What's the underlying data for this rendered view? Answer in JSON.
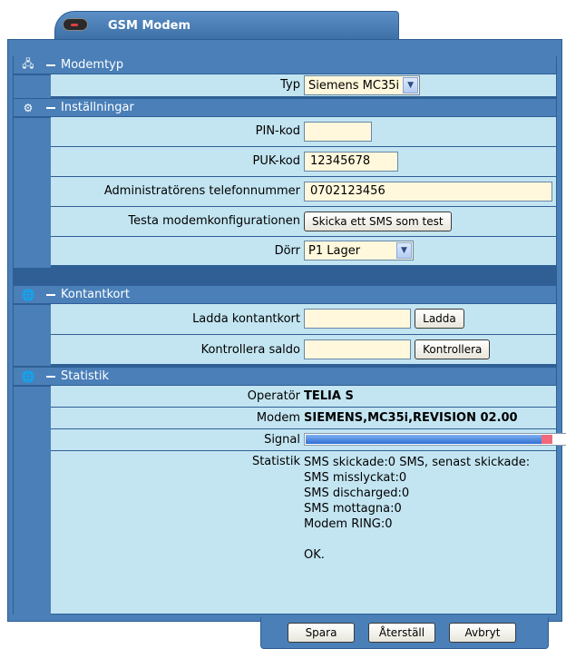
{
  "window": {
    "title": "GSM Modem"
  },
  "sections": {
    "modemtyp": {
      "title": "Modemtyp",
      "typ_label": "Typ",
      "typ_value": "Siemens MC35i"
    },
    "installningar": {
      "title": "Inställningar",
      "pin_label": "PIN-kod",
      "pin_value": "",
      "puk_label": "PUK-kod",
      "puk_value": "12345678",
      "admin_label": "Administratörens telefonnummer",
      "admin_value": "0702123456",
      "test_label": "Testa modemkonfigurationen",
      "test_button": "Skicka ett SMS som test",
      "door_label": "Dörr",
      "door_value": "P1 Lager"
    },
    "kontantkort": {
      "title": "Kontantkort",
      "load_label": "Ladda kontantkort",
      "load_value": "",
      "load_button": "Ladda",
      "balance_label": "Kontrollera saldo",
      "balance_value": "",
      "balance_button": "Kontrollera"
    },
    "statistik": {
      "title": "Statistik",
      "operator_label": "Operatör",
      "operator_value": "TELIA S",
      "modem_label": "Modem",
      "modem_value": "SIEMENS,MC35i,REVISION 02.00",
      "signal_label": "Signal",
      "signal_level": 0.95,
      "stats_label": "Statistik",
      "stats_lines": [
        "SMS skickade:0 SMS, senast skickade:",
        "SMS misslyckat:0",
        "SMS discharged:0",
        "SMS mottagna:0",
        "Modem RING:0",
        "",
        "OK."
      ]
    }
  },
  "footer": {
    "save": "Spara",
    "reset": "Återställ",
    "cancel": "Avbryt"
  },
  "colors": {
    "frame": "#4a7fb8",
    "row_bg": "#c3e5f2",
    "input_bg": "#fff8dc"
  }
}
